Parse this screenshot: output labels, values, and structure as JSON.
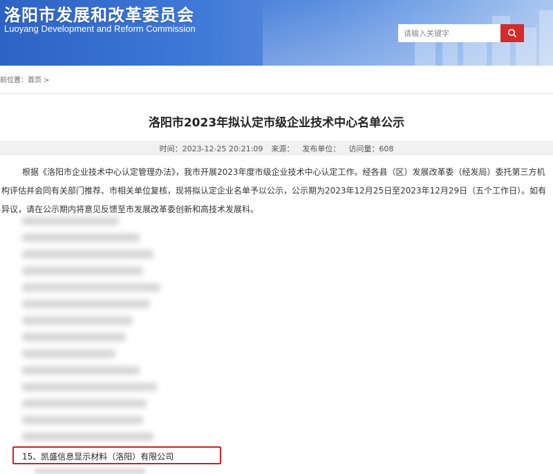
{
  "header": {
    "title_cn": "洛阳市发展和改革委员会",
    "title_en": "Luoyang Development and Reform Commission",
    "search_placeholder": "请输入关键字",
    "search_icon": "search-icon",
    "accent_color": "#d42b2b"
  },
  "breadcrumb": {
    "prefix": "前位置：",
    "home": "首页",
    "sep": " >"
  },
  "article": {
    "title": "洛阳市2023年拟认定市级企业技术中心名单公示",
    "meta": {
      "time_label": "时间：",
      "time_value": "2023-12-25 20:21:09",
      "source_label": "来源：",
      "publisher_label": "发布单位：",
      "views_label": "访问量：",
      "views_value": "608"
    },
    "body": "根据《洛阳市企业技术中心认定管理办法》，我市开展2023年度市级企业技术中心认定工作。经各县（区）发展改革委（经发局）委托第三方机构评估并会同有关部门推荐、市相关单位复核，现将拟认定企业名单予以公示，公示期为2023年12月25日至2023年12月29日（五个工作日）。如有异议，请在公示期内将意见反馈至市发展改革委创新和高技术发展科。",
    "highlighted_item": "15、凯盛信息显示材料（洛阳）有限公司"
  }
}
